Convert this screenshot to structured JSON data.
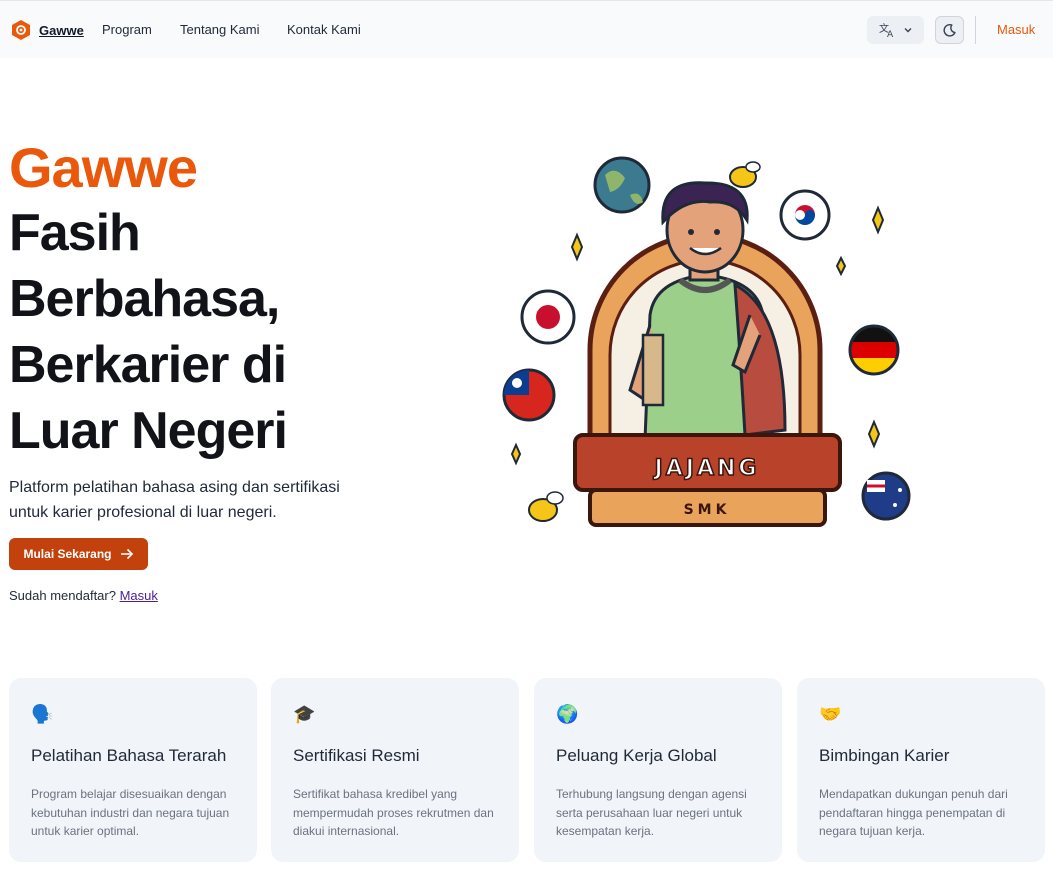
{
  "nav": {
    "brand": "Gawwe",
    "links": [
      "Program",
      "Tentang Kami",
      "Kontak Kami"
    ],
    "language_icon": "translate-icon",
    "theme_icon": "moon-icon",
    "login": "Masuk"
  },
  "hero": {
    "brand": "Gawwe",
    "title_lines": [
      "Fasih",
      "Berbahasa,",
      "Berkarier di",
      "Luar Negeri"
    ],
    "description": "Platform pelatihan bahasa asing dan sertifikasi untuk karier profesional di luar negeri.",
    "cta": "Mulai Sekarang",
    "already_text": "Sudah mendaftar?",
    "already_link": "Masuk"
  },
  "illustration": {
    "banner": "JAJANG",
    "sub": "SMK"
  },
  "features": [
    {
      "icon": "🗣️",
      "title": "Pelatihan Bahasa Terarah",
      "desc": "Program belajar disesuaikan dengan kebutuhan industri dan negara tujuan untuk karier optimal."
    },
    {
      "icon": "🎓",
      "title": "Sertifikasi Resmi",
      "desc": "Sertifikat bahasa kredibel yang mempermudah proses rekrutmen dan diakui internasional."
    },
    {
      "icon": "🌍",
      "title": "Peluang Kerja Global",
      "desc": "Terhubung langsung dengan agensi serta perusahaan luar negeri untuk kesempatan kerja."
    },
    {
      "icon": "🤝",
      "title": "Bimbingan Karier",
      "desc": "Mendapatkan dukungan penuh dari pendaftaran hingga penempatan di negara tujuan kerja."
    }
  ],
  "colors": {
    "accent": "#ea580c",
    "cta": "#c2410c"
  }
}
